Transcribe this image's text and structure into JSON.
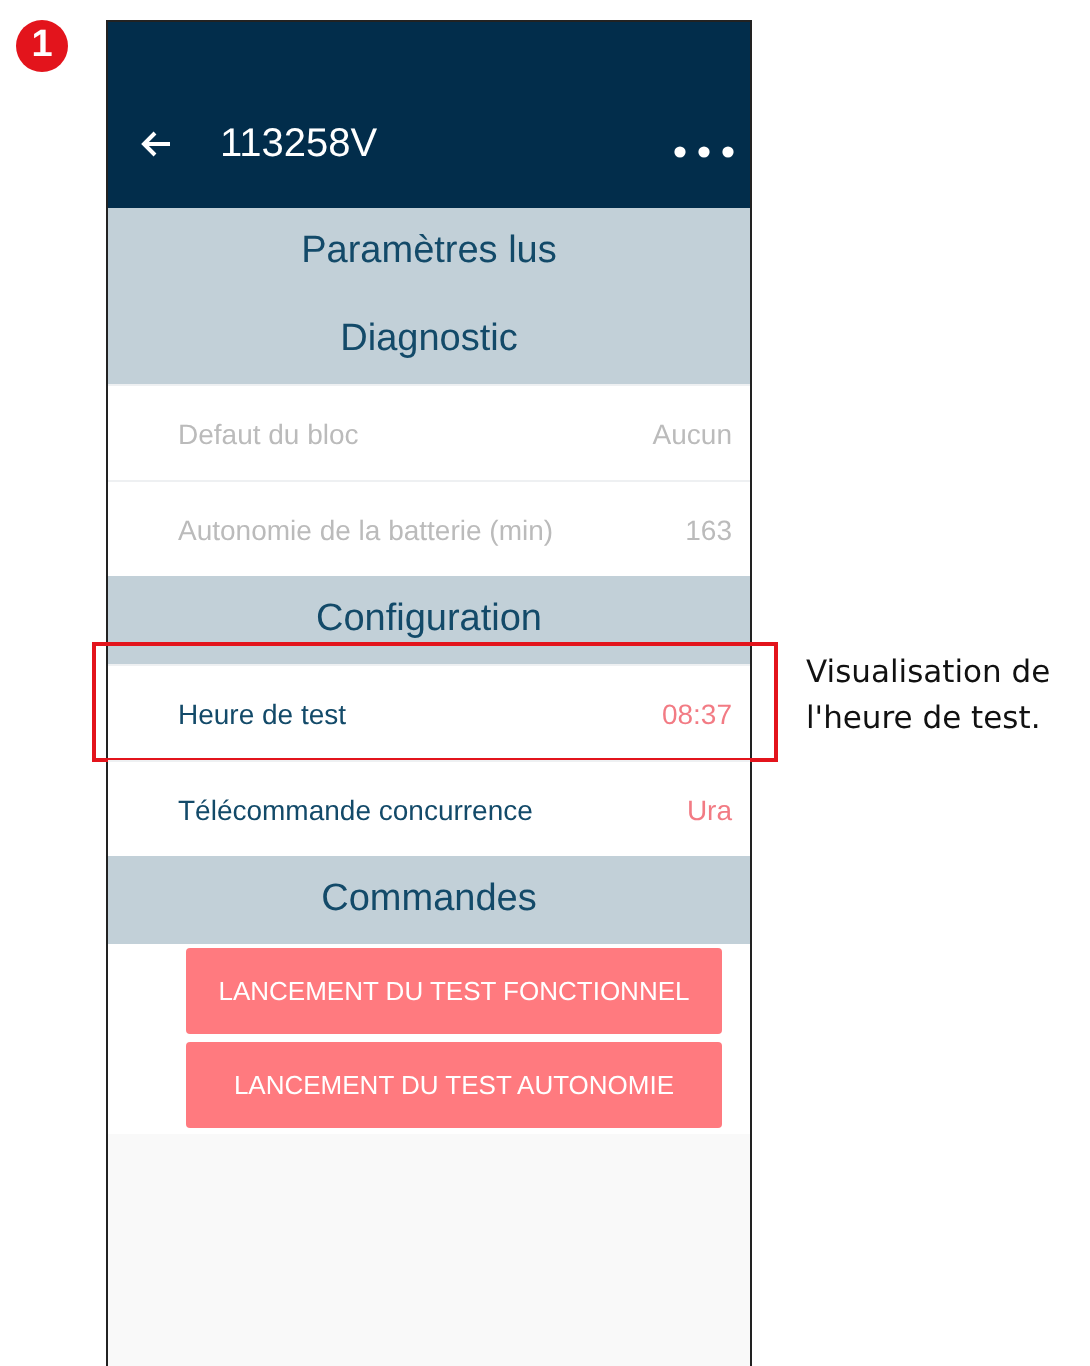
{
  "step_badge": "1",
  "app_bar": {
    "title": "113258V"
  },
  "sections": [
    {
      "title": "Paramètres lus"
    },
    {
      "title": "Diagnostic",
      "rows": [
        {
          "label": "Defaut du bloc",
          "value": "Aucun",
          "disabled": true
        },
        {
          "label": "Autonomie de la batterie (min)",
          "value": "163",
          "disabled": true
        }
      ]
    },
    {
      "title": "Configuration",
      "rows": [
        {
          "label": "Heure de test",
          "value": "08:37",
          "disabled": false,
          "highlighted": true
        },
        {
          "label": "Télécommande concurrence",
          "value": "Ura",
          "disabled": false,
          "highlighted": false
        }
      ]
    },
    {
      "title": "Commandes",
      "buttons": [
        "LANCEMENT DU TEST FONCTIONNEL",
        "LANCEMENT DU TEST AUTONOMIE"
      ]
    }
  ],
  "callout": "Visualisation de l'heure de test."
}
